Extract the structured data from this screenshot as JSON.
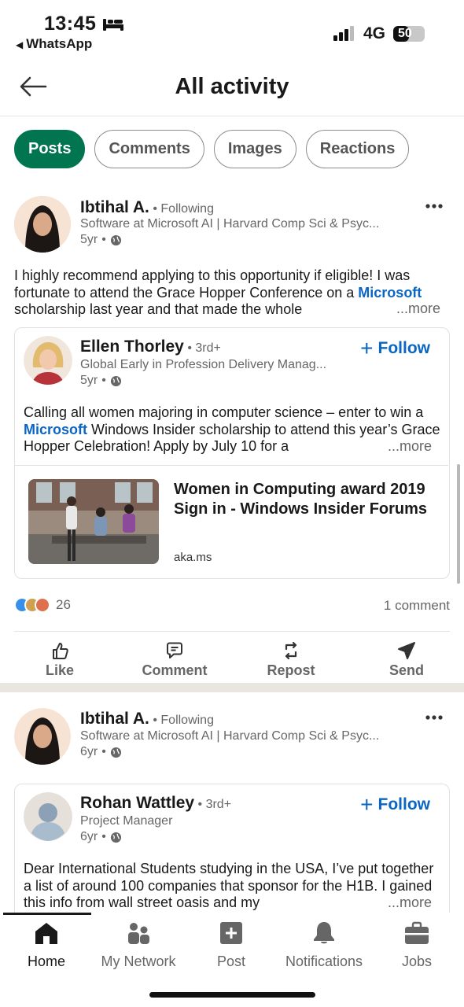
{
  "status_bar": {
    "time": "13:45",
    "back_app": "WhatsApp",
    "network": "4G",
    "battery": "50",
    "battery_level": 0.5
  },
  "header": {
    "title": "All activity"
  },
  "filters": {
    "chips": [
      {
        "label": "Posts",
        "active": true
      },
      {
        "label": "Comments",
        "active": false
      },
      {
        "label": "Images",
        "active": false
      },
      {
        "label": "Reactions",
        "active": false
      }
    ]
  },
  "posts": [
    {
      "author": {
        "name": "Ibtihal A.",
        "relation": "Following",
        "headline": "Software at Microsoft AI | Harvard Comp Sci & Psyc...",
        "time": "5yr"
      },
      "text": {
        "before_link": "I highly recommend applying to this opportunity if eligible! I was fortunate to attend the Grace Hopper Conference on a ",
        "link": "Microsoft",
        "after_link": " scholarship last year and that made the whole",
        "more": "...more"
      },
      "shared": {
        "author": {
          "name": "Ellen Thorley",
          "relation": "3rd+",
          "headline": "Global Early in Profession Delivery Manag...",
          "time": "5yr"
        },
        "follow_label": "Follow",
        "text": {
          "before_link": "Calling all women majoring in computer science – enter to win a ",
          "link": "Microsoft",
          "after_link": " Windows Insider scholarship to attend this year’s Grace Hopper Celebration! Apply by July 10 for a",
          "more": "...more"
        },
        "article": {
          "title": "Women in Computing award 2019 Sign in - Windows Insider Forums",
          "source": "aka.ms"
        }
      },
      "reactions_count": "26",
      "comments": "1 comment",
      "actions": [
        "Like",
        "Comment",
        "Repost",
        "Send"
      ]
    },
    {
      "author": {
        "name": "Ibtihal A.",
        "relation": "Following",
        "headline": "Software at Microsoft AI | Harvard Comp Sci & Psyc...",
        "time": "6yr"
      },
      "shared": {
        "author": {
          "name": "Rohan Wattley",
          "relation": "3rd+",
          "headline": "Project Manager",
          "time": "6yr"
        },
        "follow_label": "Follow",
        "text": {
          "full": "Dear International Students studying in the USA, I’ve put together a list of around 100 companies that sponsor for the H1B. I gained this info from wall street oasis and my",
          "more": "...more"
        }
      }
    }
  ],
  "bottom_nav": {
    "items": [
      {
        "label": "Home",
        "icon": "home-icon",
        "active": true
      },
      {
        "label": "My Network",
        "icon": "network-icon",
        "active": false
      },
      {
        "label": "Post",
        "icon": "post-icon",
        "active": false
      },
      {
        "label": "Notifications",
        "icon": "bell-icon",
        "active": false
      },
      {
        "label": "Jobs",
        "icon": "briefcase-icon",
        "active": false
      }
    ]
  },
  "colors": {
    "accent_green": "#01754f",
    "link_blue": "#0a66c2",
    "text_secondary": "#666666"
  }
}
